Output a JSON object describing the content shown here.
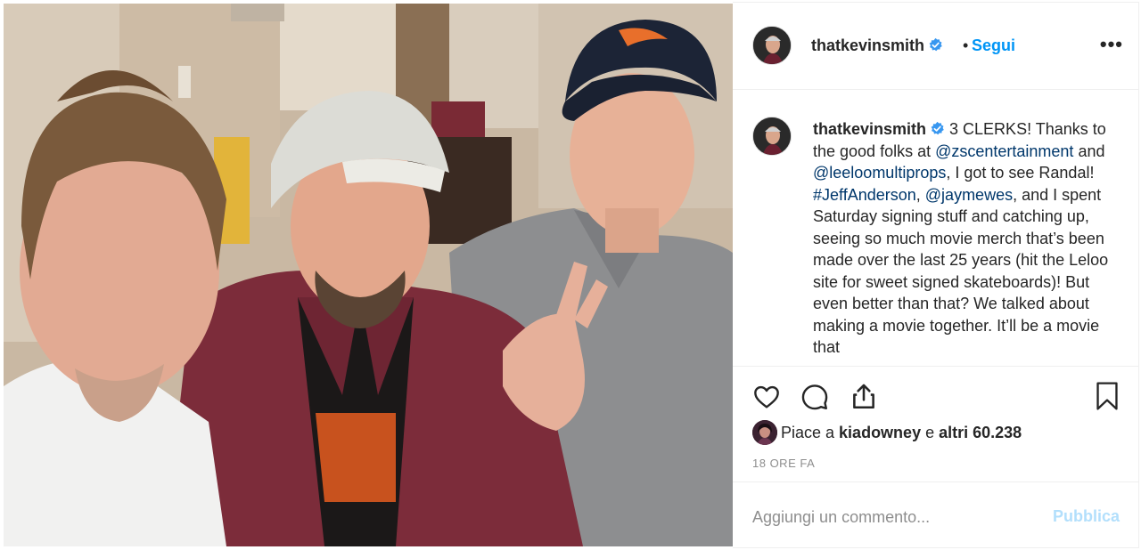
{
  "post": {
    "photo_alt": "selfie-photo"
  },
  "header": {
    "username": "thatkevinsmith",
    "dot": "•",
    "follow_label": "Segui",
    "more_label": "•••"
  },
  "caption": {
    "username": "thatkevinsmith",
    "segments": [
      {
        "text": " 3 CLERKS! Thanks to the good folks at ",
        "type": "text"
      },
      {
        "text": "@zscentertainment",
        "type": "mention"
      },
      {
        "text": " and ",
        "type": "text"
      },
      {
        "text": "@leeloomultiprops",
        "type": "mention"
      },
      {
        "text": ", I got to see Randal! ",
        "type": "text"
      },
      {
        "text": "#JeffAnderson",
        "type": "mention"
      },
      {
        "text": ", ",
        "type": "text"
      },
      {
        "text": "@jaymewes",
        "type": "mention"
      },
      {
        "text": ", and I spent Saturday signing stuff and catching up, seeing so much movie merch that’s been made over the last 25 years (hit the Leloo site for sweet signed skateboards)! But even better than that? We talked about making a movie together. It’ll be a movie that",
        "type": "text"
      }
    ]
  },
  "actions": {
    "like_icon": "heart-icon",
    "comment_icon": "comment-icon",
    "share_icon": "share-icon",
    "save_icon": "bookmark-icon"
  },
  "likes": {
    "prefix": "Piace a ",
    "user": "kiadowney",
    "middle": " e ",
    "others": "altri 60.238"
  },
  "timestamp": "18 ORE FA",
  "comment": {
    "placeholder": "Aggiungi un commento...",
    "publish_label": "Pubblica"
  },
  "colors": {
    "accent": "#0095f6",
    "mention": "#00376b",
    "publish_disabled": "#b2dffc",
    "verified": "#3897f0"
  }
}
